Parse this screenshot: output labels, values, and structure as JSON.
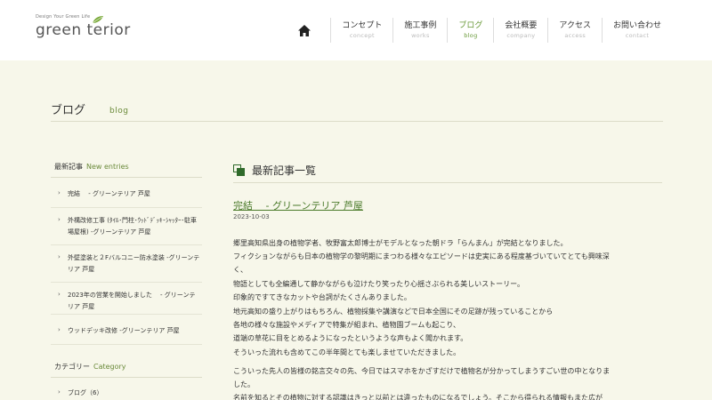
{
  "logo": {
    "tagline": "Design Your Green Life",
    "wordmark": "green terior"
  },
  "nav": {
    "items": [
      {
        "jp": "コンセプト",
        "en": "concept",
        "active": false
      },
      {
        "jp": "施工事例",
        "en": "works",
        "active": false
      },
      {
        "jp": "ブログ",
        "en": "blog",
        "active": true
      },
      {
        "jp": "会社概要",
        "en": "company",
        "active": false
      },
      {
        "jp": "アクセス",
        "en": "access",
        "active": false
      },
      {
        "jp": "お問い合わせ",
        "en": "contact",
        "active": false
      }
    ]
  },
  "page": {
    "title": "ブログ",
    "title_en": "blog"
  },
  "sidebar": {
    "new_entries": {
      "title": "最新記事",
      "title_en": "New entries",
      "items": [
        "完結　 - グリーンテリア 芦屋",
        "外構改修工事 (ﾀｲﾙ･門柱･ｳｯﾄﾞﾃﾞｯｷ･ｼｬｯﾀｰ･駐車場屋根) -グリーンテリア 芦屋",
        "外壁塗装と２Fバルコニー防水塗装 -グリーンテリア 芦屋",
        "2023年の営業を開始しました　 - グリーンテリア 芦屋",
        "ウッドデッキ改修 -グリーンテリア 芦屋"
      ]
    },
    "category": {
      "title": "カテゴリー",
      "title_en": "Category",
      "items": [
        "ブログ（6）"
      ]
    }
  },
  "main": {
    "section_title": "最新記事一覧",
    "post": {
      "title": "完結　 - グリーンテリア 芦屋",
      "date": "2023-10-03",
      "lines": [
        "郷里高知県出身の植物学者、牧野富太郎博士がモデルとなった朝ドラ「らんまん」が完結となりました。",
        "フィクションながらも日本の植物学の黎明期にまつわる様々なエピソードは史実にある程度基づいていてとても興味深",
        "く、",
        "物語としても全編通して静かながらも泣けたり笑ったり心揺さぶられる美しいストーリー。",
        "印象的ですてきなカットや台詞がたくさんありました。",
        "地元高知の盛り上がりはもちろん、植物採集や講演などで日本全国にその足跡が残っていることから",
        "各地の様々な施設やメディアで特集が組まれ、植物園ブームも起こり、",
        "道端の草花に目をとめるようになったというような声もよく聞かれます。",
        "そういった流れも含めてこの半年間とても楽しませていただきました。",
        "こういった先人の皆様の銘言交々の先、今日ではスマホをかざすだけで植物名が分かってしまうすごい世の中となりま",
        "した。",
        "名前を知るとその植物に対する認識はきっと以前とは違ったものになるでしょう。そこから得られる情報もまた広が"
      ]
    }
  },
  "colors": {
    "accent": "#6a9a3a",
    "band": "#f7f7ea"
  }
}
